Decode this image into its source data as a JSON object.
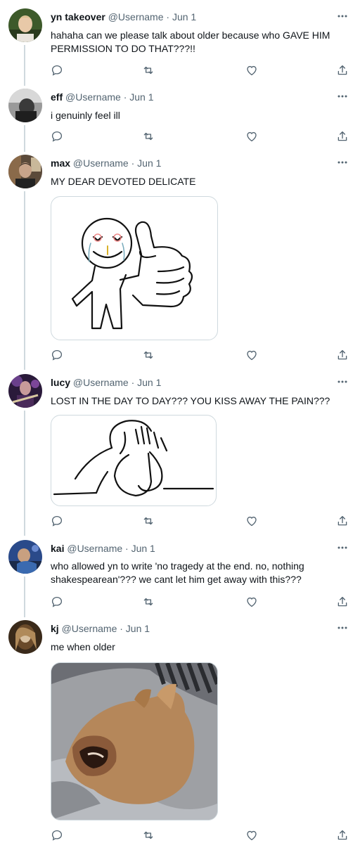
{
  "tweets": [
    {
      "name": "yn takeover",
      "meta": " @Username · Jun 1",
      "text": "hahaha can we please talk about older because who GAVE HIM PERMISSION TO DO THAT???!!"
    },
    {
      "name": "eff",
      "meta": " @Username · Jun 1",
      "text": "i genuinly feel ill"
    },
    {
      "name": "max",
      "meta": " @Username · Jun 1",
      "text": "MY DEAR DEVOTED DELICATE"
    },
    {
      "name": "lucy",
      "meta": " @Username · Jun 1",
      "text": "LOST IN THE DAY TO DAY??? YOU KISS AWAY THE PAIN???"
    },
    {
      "name": "kai",
      "meta": " @Username · Jun 1",
      "text": "who allowed yn to write 'no tragedy at the end. no, nothing shakespearean'??? we cant let him get away with this???"
    },
    {
      "name": "kj",
      "meta": " @Username · Jun 1",
      "text": "me when older"
    }
  ],
  "icons": [
    "reply-icon",
    "retweet-icon",
    "like-icon",
    "share-icon",
    "more-icon"
  ],
  "colors": {
    "text": "#0f1419",
    "secondary": "#536471",
    "thread": "#cfd9de"
  }
}
